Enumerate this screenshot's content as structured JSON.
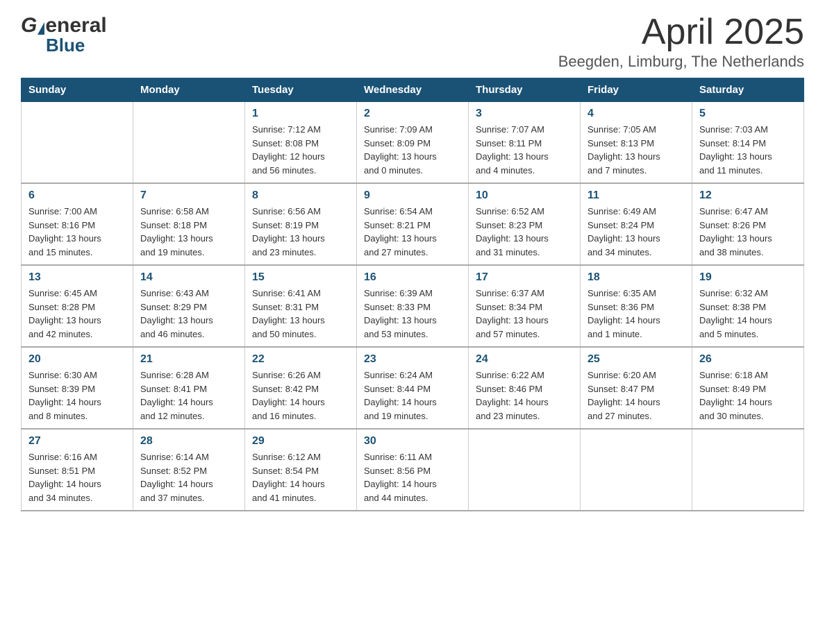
{
  "header": {
    "logo_general": "General",
    "logo_blue": "Blue",
    "month_title": "April 2025",
    "location": "Beegden, Limburg, The Netherlands"
  },
  "calendar": {
    "days_of_week": [
      "Sunday",
      "Monday",
      "Tuesday",
      "Wednesday",
      "Thursday",
      "Friday",
      "Saturday"
    ],
    "weeks": [
      [
        {
          "day": "",
          "info": ""
        },
        {
          "day": "",
          "info": ""
        },
        {
          "day": "1",
          "info": "Sunrise: 7:12 AM\nSunset: 8:08 PM\nDaylight: 12 hours\nand 56 minutes."
        },
        {
          "day": "2",
          "info": "Sunrise: 7:09 AM\nSunset: 8:09 PM\nDaylight: 13 hours\nand 0 minutes."
        },
        {
          "day": "3",
          "info": "Sunrise: 7:07 AM\nSunset: 8:11 PM\nDaylight: 13 hours\nand 4 minutes."
        },
        {
          "day": "4",
          "info": "Sunrise: 7:05 AM\nSunset: 8:13 PM\nDaylight: 13 hours\nand 7 minutes."
        },
        {
          "day": "5",
          "info": "Sunrise: 7:03 AM\nSunset: 8:14 PM\nDaylight: 13 hours\nand 11 minutes."
        }
      ],
      [
        {
          "day": "6",
          "info": "Sunrise: 7:00 AM\nSunset: 8:16 PM\nDaylight: 13 hours\nand 15 minutes."
        },
        {
          "day": "7",
          "info": "Sunrise: 6:58 AM\nSunset: 8:18 PM\nDaylight: 13 hours\nand 19 minutes."
        },
        {
          "day": "8",
          "info": "Sunrise: 6:56 AM\nSunset: 8:19 PM\nDaylight: 13 hours\nand 23 minutes."
        },
        {
          "day": "9",
          "info": "Sunrise: 6:54 AM\nSunset: 8:21 PM\nDaylight: 13 hours\nand 27 minutes."
        },
        {
          "day": "10",
          "info": "Sunrise: 6:52 AM\nSunset: 8:23 PM\nDaylight: 13 hours\nand 31 minutes."
        },
        {
          "day": "11",
          "info": "Sunrise: 6:49 AM\nSunset: 8:24 PM\nDaylight: 13 hours\nand 34 minutes."
        },
        {
          "day": "12",
          "info": "Sunrise: 6:47 AM\nSunset: 8:26 PM\nDaylight: 13 hours\nand 38 minutes."
        }
      ],
      [
        {
          "day": "13",
          "info": "Sunrise: 6:45 AM\nSunset: 8:28 PM\nDaylight: 13 hours\nand 42 minutes."
        },
        {
          "day": "14",
          "info": "Sunrise: 6:43 AM\nSunset: 8:29 PM\nDaylight: 13 hours\nand 46 minutes."
        },
        {
          "day": "15",
          "info": "Sunrise: 6:41 AM\nSunset: 8:31 PM\nDaylight: 13 hours\nand 50 minutes."
        },
        {
          "day": "16",
          "info": "Sunrise: 6:39 AM\nSunset: 8:33 PM\nDaylight: 13 hours\nand 53 minutes."
        },
        {
          "day": "17",
          "info": "Sunrise: 6:37 AM\nSunset: 8:34 PM\nDaylight: 13 hours\nand 57 minutes."
        },
        {
          "day": "18",
          "info": "Sunrise: 6:35 AM\nSunset: 8:36 PM\nDaylight: 14 hours\nand 1 minute."
        },
        {
          "day": "19",
          "info": "Sunrise: 6:32 AM\nSunset: 8:38 PM\nDaylight: 14 hours\nand 5 minutes."
        }
      ],
      [
        {
          "day": "20",
          "info": "Sunrise: 6:30 AM\nSunset: 8:39 PM\nDaylight: 14 hours\nand 8 minutes."
        },
        {
          "day": "21",
          "info": "Sunrise: 6:28 AM\nSunset: 8:41 PM\nDaylight: 14 hours\nand 12 minutes."
        },
        {
          "day": "22",
          "info": "Sunrise: 6:26 AM\nSunset: 8:42 PM\nDaylight: 14 hours\nand 16 minutes."
        },
        {
          "day": "23",
          "info": "Sunrise: 6:24 AM\nSunset: 8:44 PM\nDaylight: 14 hours\nand 19 minutes."
        },
        {
          "day": "24",
          "info": "Sunrise: 6:22 AM\nSunset: 8:46 PM\nDaylight: 14 hours\nand 23 minutes."
        },
        {
          "day": "25",
          "info": "Sunrise: 6:20 AM\nSunset: 8:47 PM\nDaylight: 14 hours\nand 27 minutes."
        },
        {
          "day": "26",
          "info": "Sunrise: 6:18 AM\nSunset: 8:49 PM\nDaylight: 14 hours\nand 30 minutes."
        }
      ],
      [
        {
          "day": "27",
          "info": "Sunrise: 6:16 AM\nSunset: 8:51 PM\nDaylight: 14 hours\nand 34 minutes."
        },
        {
          "day": "28",
          "info": "Sunrise: 6:14 AM\nSunset: 8:52 PM\nDaylight: 14 hours\nand 37 minutes."
        },
        {
          "day": "29",
          "info": "Sunrise: 6:12 AM\nSunset: 8:54 PM\nDaylight: 14 hours\nand 41 minutes."
        },
        {
          "day": "30",
          "info": "Sunrise: 6:11 AM\nSunset: 8:56 PM\nDaylight: 14 hours\nand 44 minutes."
        },
        {
          "day": "",
          "info": ""
        },
        {
          "day": "",
          "info": ""
        },
        {
          "day": "",
          "info": ""
        }
      ]
    ]
  }
}
